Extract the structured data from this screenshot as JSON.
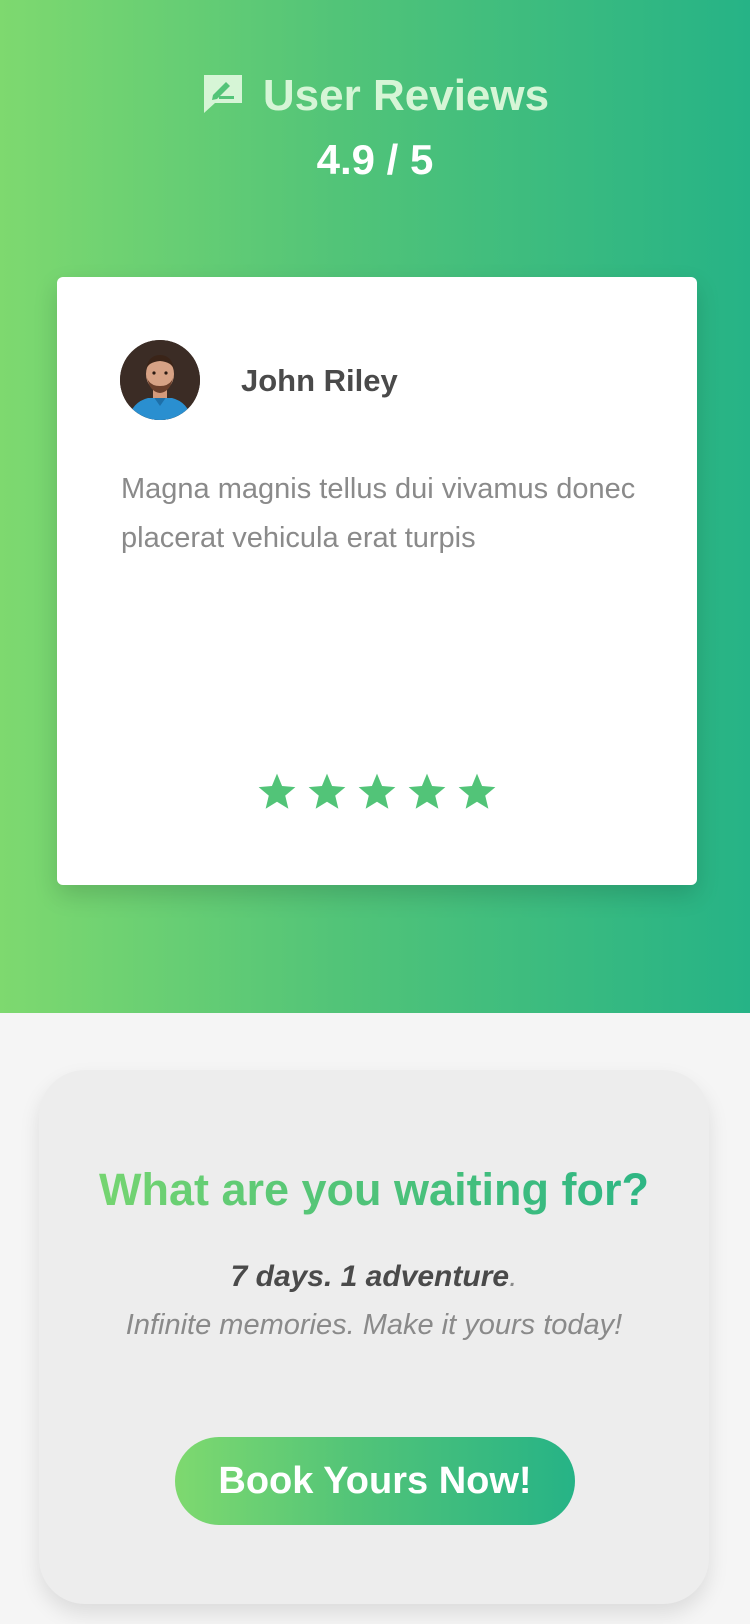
{
  "hero": {
    "title": "User Reviews",
    "title_icon": "chat-edit-icon",
    "rating": "4.9 / 5",
    "gradient": [
      "#7ed96f",
      "#26b386"
    ]
  },
  "review": {
    "name": "John Riley",
    "text": "Magna magnis tellus dui vivamus donec placerat vehicula erat turpis",
    "stars": 5,
    "star_color": "#52c478"
  },
  "cta": {
    "heading": "What are you waiting for?",
    "line1_bold": "7 days. 1 adventure",
    "line1_end": ".",
    "line2": "Infinite memories. Make it yours today!",
    "button_label": "Book Yours Now!"
  }
}
